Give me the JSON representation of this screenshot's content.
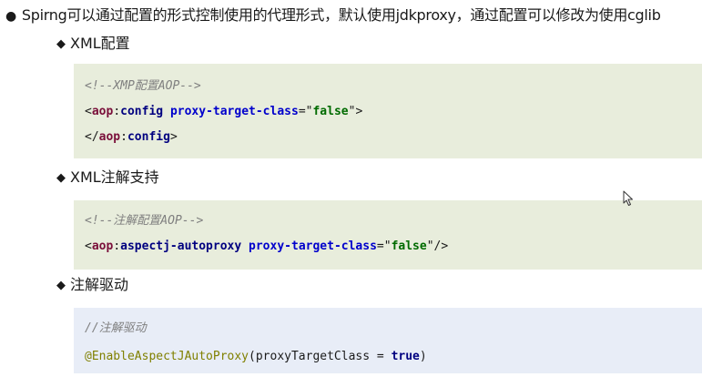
{
  "intro": {
    "bullet": "●",
    "text": "Spirng可以通过配置的形式控制使用的代理形式，默认使用jdkproxy，通过配置可以修改为使用cglib"
  },
  "sections": [
    {
      "marker": "◆",
      "heading": "XML配置",
      "code": {
        "comment": "<!--XMP配置AOP-->",
        "line2": {
          "open": "<",
          "ns": "aop",
          "colon": ":",
          "tag": "config",
          "attr": "proxy-target-class",
          "eq": "=",
          "quote_open": "\"",
          "value": "false",
          "quote_close": "\"",
          "close": ">"
        },
        "line3": {
          "open": "</",
          "ns": "aop",
          "colon": ":",
          "tag": "config",
          "close": ">"
        }
      }
    },
    {
      "marker": "◆",
      "heading": "XML注解支持",
      "code": {
        "comment": "<!--注解配置AOP-->",
        "line2": {
          "open": "<",
          "ns": "aop",
          "colon": ":",
          "tag": "aspectj-autoproxy",
          "attr": "proxy-target-class",
          "eq": "=",
          "quote_open": "\"",
          "value": "false",
          "quote_close": "\"",
          "close": "/>"
        }
      }
    },
    {
      "marker": "◆",
      "heading": "注解驱动",
      "code": {
        "comment": "//注解驱动",
        "annotation": "@EnableAspectJAutoProxy",
        "args_open": "(proxyTargetClass = ",
        "args_value": "true",
        "args_close": ")"
      }
    }
  ],
  "colors": {
    "xml_block_bg": "#e8eddc",
    "java_block_bg": "#e8edf7",
    "comment": "#7f7f7f",
    "xml_namespace": "#7a0f3a",
    "xml_tag": "#000080",
    "xml_attr": "#0000cc",
    "xml_value": "#006b00",
    "annotation": "#808000"
  },
  "icons": {
    "cursor": "mouse-pointer-icon"
  }
}
